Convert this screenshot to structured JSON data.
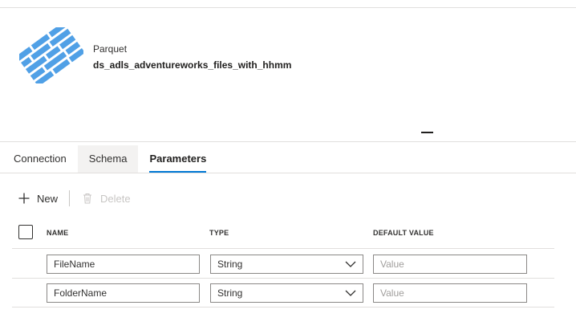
{
  "dataset": {
    "type_label": "Parquet",
    "name": "ds_adls_adventureworks_files_with_hhmm"
  },
  "tabs": [
    {
      "label": "Connection"
    },
    {
      "label": "Schema"
    },
    {
      "label": "Parameters"
    }
  ],
  "active_tab": "Parameters",
  "toolbar": {
    "new_label": "New",
    "delete_label": "Delete"
  },
  "table": {
    "columns": [
      "NAME",
      "TYPE",
      "DEFAULT VALUE"
    ],
    "rows": [
      {
        "name": "FileName",
        "type": "String",
        "default_placeholder": "Value"
      },
      {
        "name": "FolderName",
        "type": "String",
        "default_placeholder": "Value"
      }
    ]
  },
  "colors": {
    "logo_blue": "#50a0e6",
    "accent": "#0078d4"
  },
  "icons": {
    "logo": "parquet-logo-icon",
    "new": "plus-icon",
    "delete": "trash-icon",
    "dropdown": "chevron-down-icon"
  }
}
